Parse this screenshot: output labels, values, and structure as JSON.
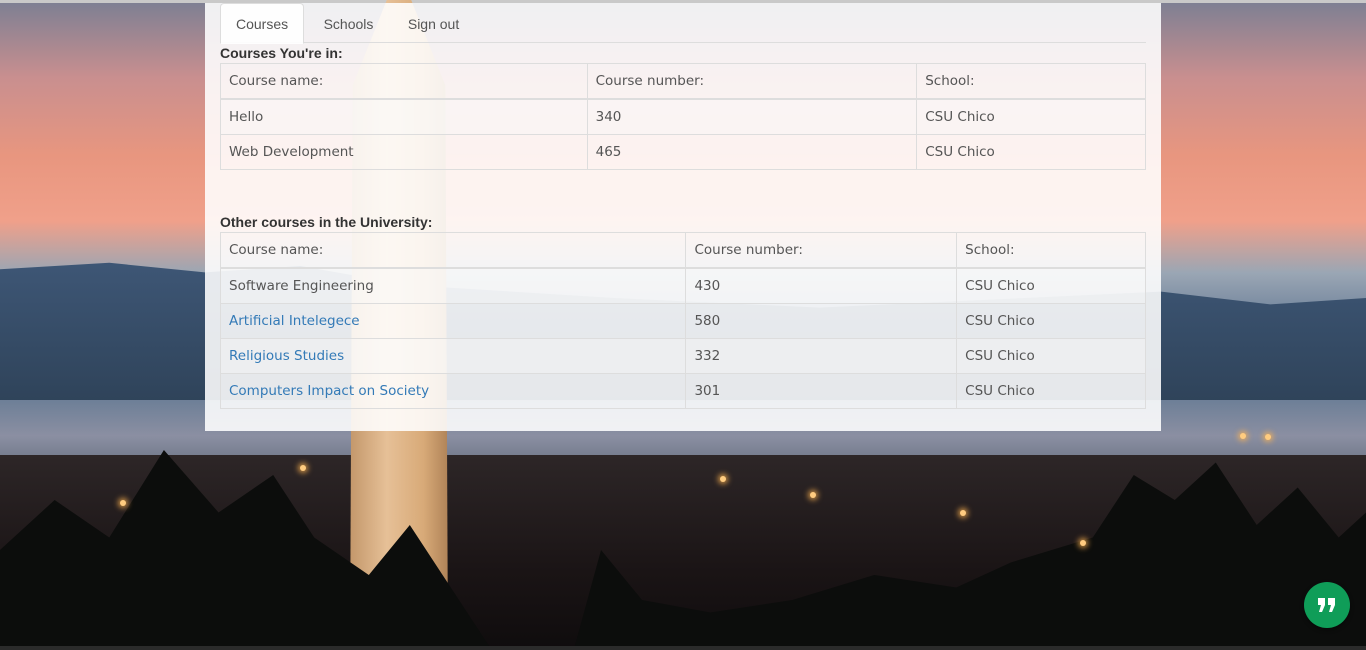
{
  "nav": {
    "tabs": [
      {
        "label": "Courses",
        "active": true
      },
      {
        "label": "Schools",
        "active": false
      },
      {
        "label": "Sign out",
        "active": false
      }
    ]
  },
  "enrolled": {
    "title": "Courses You're in:",
    "headers": [
      "Course name:",
      "Course number:",
      "School:"
    ],
    "rows": [
      {
        "name": "Hello",
        "number": "340",
        "school": "CSU Chico"
      },
      {
        "name": "Web Development",
        "number": "465",
        "school": "CSU Chico"
      }
    ]
  },
  "other": {
    "title": "Other courses in the University:",
    "headers": [
      "Course name:",
      "Course number:",
      "School:"
    ],
    "rows": [
      {
        "name": "Software Engineering",
        "number": "430",
        "school": "CSU Chico",
        "link": false
      },
      {
        "name": "Artificial Intelegece",
        "number": "580",
        "school": "CSU Chico",
        "link": true
      },
      {
        "name": "Religious Studies",
        "number": "332",
        "school": "CSU Chico",
        "link": true
      },
      {
        "name": "Computers Impact on Society",
        "number": "301",
        "school": "CSU Chico",
        "link": true
      }
    ]
  },
  "fab": {
    "icon": "hangouts-quote-icon",
    "color": "#0f9d58"
  },
  "colors": {
    "link": "#337ab7",
    "text": "#555555",
    "accent": "#0f9d58"
  }
}
